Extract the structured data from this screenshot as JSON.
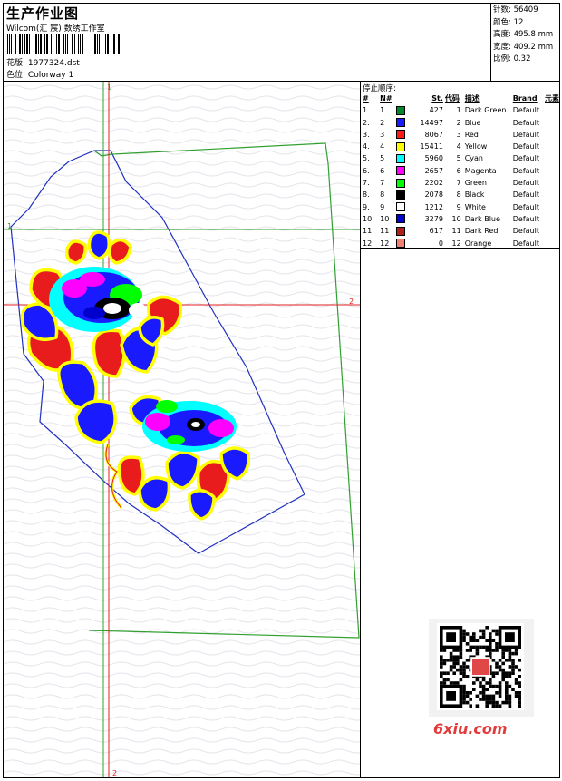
{
  "header": {
    "title": "生产作业图",
    "company": "Wilcom(汇 宸) 数绣工作室",
    "design_label": "花版:",
    "design_value": "1977324.dst",
    "colorway_label": "色位:",
    "colorway_value": "Colorway 1"
  },
  "stats": {
    "stitches": "针数: 56409",
    "colors": "颜色: 12",
    "height": "高度: 495.8 mm",
    "width": "宽度: 409.2 mm",
    "scale": "比例: 0.32"
  },
  "canvas": {
    "guide_labels": [
      "1",
      "1",
      "2",
      "2"
    ]
  },
  "panel": {
    "title": "停止顺序:",
    "headers": [
      "#",
      "N#",
      "St.",
      "代码",
      "描述",
      "Brand",
      "元素"
    ],
    "rows": [
      {
        "idx": "1.",
        "n": "1",
        "color": "#008a2e",
        "st": "427",
        "code": "1",
        "desc": "Dark Green",
        "brand": "Default"
      },
      {
        "idx": "2.",
        "n": "2",
        "color": "#1a1aff",
        "st": "14497",
        "code": "2",
        "desc": "Blue",
        "brand": "Default"
      },
      {
        "idx": "3.",
        "n": "3",
        "color": "#ff1a1a",
        "st": "8067",
        "code": "3",
        "desc": "Red",
        "brand": "Default"
      },
      {
        "idx": "4.",
        "n": "4",
        "color": "#ffff00",
        "st": "15411",
        "code": "4",
        "desc": "Yellow",
        "brand": "Default"
      },
      {
        "idx": "5.",
        "n": "5",
        "color": "#00ffff",
        "st": "5960",
        "code": "5",
        "desc": "Cyan",
        "brand": "Default"
      },
      {
        "idx": "6.",
        "n": "6",
        "color": "#ff00ff",
        "st": "2657",
        "code": "6",
        "desc": "Magenta",
        "brand": "Default"
      },
      {
        "idx": "7.",
        "n": "7",
        "color": "#00ff00",
        "st": "2202",
        "code": "7",
        "desc": "Green",
        "brand": "Default"
      },
      {
        "idx": "8.",
        "n": "8",
        "color": "#000000",
        "st": "2078",
        "code": "8",
        "desc": "Black",
        "brand": "Default"
      },
      {
        "idx": "9.",
        "n": "9",
        "color": "#ffffff",
        "st": "1212",
        "code": "9",
        "desc": "White",
        "brand": "Default"
      },
      {
        "idx": "10.",
        "n": "10",
        "color": "#0000cc",
        "st": "3279",
        "code": "10",
        "desc": "Dark Blue",
        "brand": "Default"
      },
      {
        "idx": "11.",
        "n": "11",
        "color": "#b0201a",
        "st": "617",
        "code": "11",
        "desc": "Dark Red",
        "brand": "Default"
      },
      {
        "idx": "12.",
        "n": "12",
        "color": "#f08070",
        "st": "0",
        "code": "12",
        "desc": "Orange",
        "brand": "Default"
      }
    ]
  },
  "watermark": {
    "site": "6xiu.com"
  }
}
